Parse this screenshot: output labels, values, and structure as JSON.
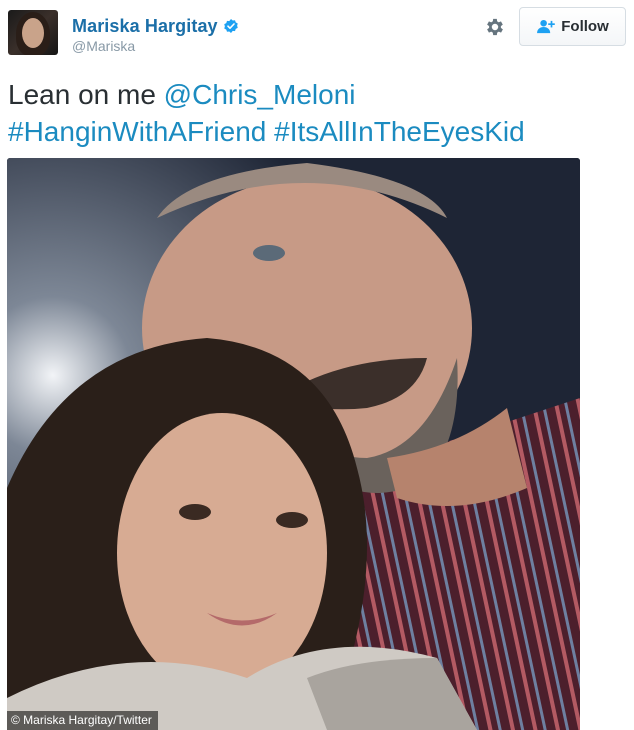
{
  "tweet": {
    "display_name": "Mariska Hargitay",
    "handle": "@Mariska",
    "follow_label": "Follow",
    "text_plain": "Lean on me",
    "mention": "@Chris_Meloni",
    "hashtag_1": "#HanginWithAFriend",
    "hashtag_2": "#ItsAllInTheEyesKid"
  },
  "photo": {
    "credit": "© Mariska Hargitay/Twitter"
  },
  "colors": {
    "name": "#1b6fa8",
    "link": "#1b8bc0",
    "verified_badge": "#1da1f2",
    "text": "#292f33",
    "handle": "#8899a6"
  },
  "icons": {
    "verified": "verified-badge-icon",
    "settings": "gear-icon",
    "follow": "add-user-icon"
  }
}
